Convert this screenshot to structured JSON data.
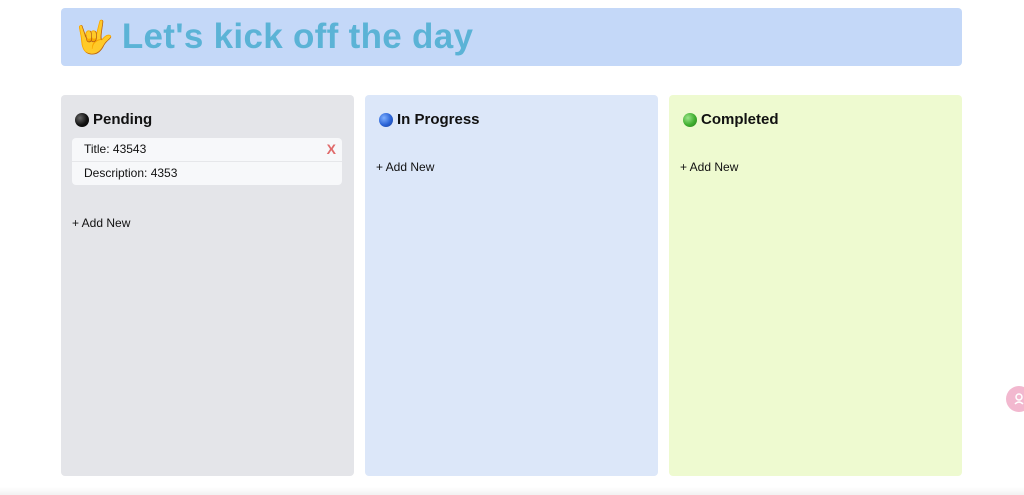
{
  "header": {
    "emoji": "🤟",
    "title": "Let's kick off the day"
  },
  "columns": [
    {
      "title": "Pending",
      "dot_color": "#000000",
      "background": "#e4e5e9",
      "cards": [
        {
          "title": "Title: 43543",
          "description": "Description: 4353",
          "delete_label": "X"
        }
      ],
      "add_label": "+ Add New"
    },
    {
      "title": "In Progress",
      "dot_color": "#2a63d6",
      "background": "#dce7f9",
      "cards": [],
      "add_label": "+ Add New"
    },
    {
      "title": "Completed",
      "dot_color": "#3fae2f",
      "background": "#eefad0",
      "cards": [],
      "add_label": "+ Add New"
    }
  ],
  "colors": {
    "header_bg": "#c4d8f8",
    "header_text": "#5bb3d6",
    "delete_x": "#e06b6b"
  }
}
